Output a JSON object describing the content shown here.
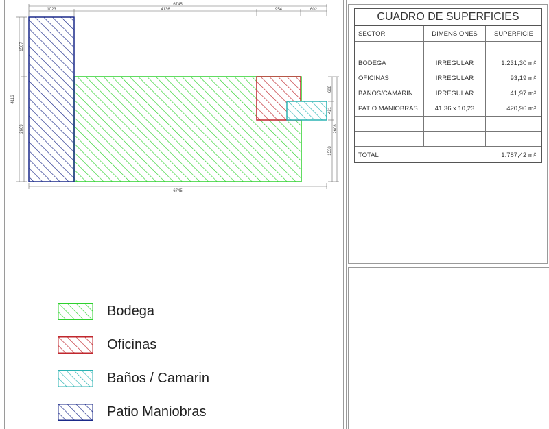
{
  "plan": {
    "dims": {
      "top_total": "6745",
      "top_a": "1023",
      "top_b": "4136",
      "top_c": "954",
      "top_d": "602",
      "left_total": "4116",
      "left_top": "1507",
      "left_bottom": "2609",
      "right_a": "608",
      "right_b": "421",
      "right_c": "1538",
      "right_d": "2608",
      "bottom_total": "6745"
    }
  },
  "table": {
    "title": "CUADRO DE SUPERFICIES",
    "headers": [
      "SECTOR",
      "DIMENSIONES",
      "SUPERFICIE"
    ],
    "rows": [
      [
        "",
        "",
        ""
      ],
      [
        "BODEGA",
        "IRREGULAR",
        "1.231,30 m²"
      ],
      [
        "OFICINAS",
        "IRREGULAR",
        "93,19 m²"
      ],
      [
        "BAÑOS/CAMARIN",
        "IRREGULAR",
        "41,97 m²"
      ],
      [
        "PATIO MANIOBRAS",
        "41,36 x 10,23",
        "420,96 m²"
      ],
      [
        "",
        "",
        ""
      ],
      [
        "",
        "",
        ""
      ]
    ],
    "total_label": "TOTAL",
    "total_value": "1.787,42 m²"
  },
  "legend": [
    {
      "label": "Bodega",
      "color": "#2ed12e"
    },
    {
      "label": "Oficinas",
      "color": "#c0272d"
    },
    {
      "label": "Baños / Camarin",
      "color": "#2bb3b3"
    },
    {
      "label": "Patio Maniobras",
      "color": "#1b2a8a"
    }
  ]
}
